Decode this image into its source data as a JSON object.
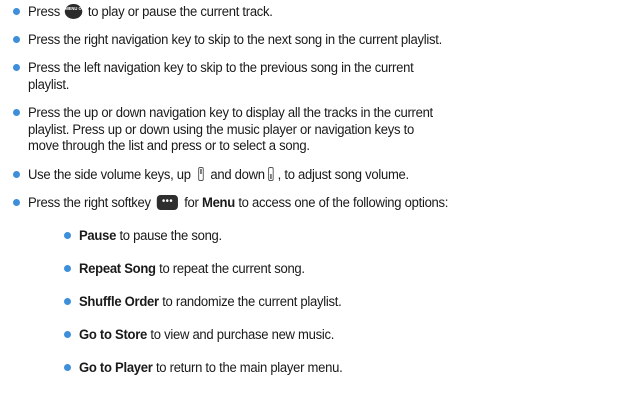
{
  "bullets": [
    {
      "text_a": "Press",
      "icon": "ok-key-icon",
      "icon_label": "MENU OK",
      "text_b": "to play or pause the current track."
    },
    {
      "text": "Press the right navigation key to skip to the next song in the current playlist."
    },
    {
      "line1": "Press the left navigation key to skip to the previous song in the current",
      "line2": "playlist."
    },
    {
      "line1": "Press the up or down navigation key to display all the tracks in the current",
      "line2": "playlist. Press up or down using the music player or navigation keys to",
      "line3": "move through the list and press or to select a song."
    },
    {
      "text_a": "Use the side volume keys, up",
      "icon_up": "volume-up-key-icon",
      "text_b": "and down",
      "icon_down": "volume-down-key-icon",
      "text_c": ", to adjust song volume."
    },
    {
      "text_a": "Press the right softkey",
      "icon": "right-softkey-icon",
      "icon_label": "•••",
      "text_b": "for",
      "bold": "Menu",
      "text_c": "to access one of the following options:"
    }
  ],
  "sub_bullets": [
    {
      "bold": "Pause",
      "text": "to pause the song."
    },
    {
      "bold": "Repeat Song",
      "text": "to repeat the current song."
    },
    {
      "bold": "Shuffle Order",
      "text": "to randomize the current playlist."
    },
    {
      "bold": "Go to Store",
      "text": "to view and purchase new music."
    },
    {
      "bold": "Go to Player",
      "text": "to return to the main player menu."
    }
  ],
  "colors": {
    "bullet": "#3d8fd9",
    "text": "#1a1a1a",
    "icon": "#2a2a2a"
  }
}
